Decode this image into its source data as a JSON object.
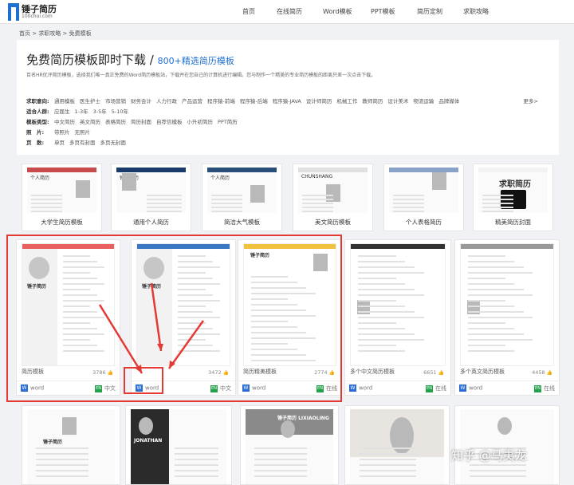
{
  "logo": {
    "name": "锤子简历",
    "domain": "100chui.com"
  },
  "nav": [
    "首页",
    "在线简历",
    "Word模板",
    "PPT模板",
    "简历定制",
    "求职攻略"
  ],
  "breadcrumb": "首页 > 求职攻略 > 免费模板",
  "heading": {
    "title": "免费简历模板即时下载 /",
    "subtitle": "800+精选简历模板",
    "desc": "百名HR优评简历模板，选择我们唯一真正免费的Word简历模板站，下载并在您自己的计算机进行编辑。您与制作一个精美的专业简历模板的距离只差一次点击下载。"
  },
  "filters": [
    {
      "label": "求职意向:",
      "options": [
        "通用模板",
        "医生护士",
        "市场营销",
        "财务会计",
        "人力行政",
        "产品运营",
        "程序猿-前端",
        "程序猿-后端",
        "程序猿-JAVA",
        "设计师简历",
        "机械工作",
        "教师简历",
        "设计美术",
        "物流运输",
        "品牌媒体"
      ]
    },
    {
      "label": "适合人群:",
      "options": [
        "应届生",
        "1-3年",
        "3-5年",
        "5-10年"
      ]
    },
    {
      "label": "模板类型:",
      "options": [
        "中文简历",
        "英文简历",
        "表格简历",
        "简历封面",
        "自荐信模板",
        "小升初简历",
        "PPT简历"
      ]
    },
    {
      "label": "照　片:",
      "options": [
        "带照片",
        "无照片"
      ]
    },
    {
      "label": "页　数:",
      "options": [
        "单页",
        "多页有封面",
        "多页无封面"
      ]
    }
  ],
  "more": "更多>",
  "categories": [
    "大学生简历模板",
    "通用个人简历",
    "简洁大气模板",
    "美文简历模板",
    "个人表格简历",
    "精美简历封面"
  ],
  "category_thumb_texts": [
    "个人简历",
    "锤子简历",
    "个人简历",
    "CHUNSHANG",
    "",
    "求职简历"
  ],
  "templates": [
    {
      "name": "简历模板",
      "count": "3786",
      "format": "word",
      "lang": "中文"
    },
    {
      "name": "",
      "count": "3472",
      "format": "word",
      "lang": "中文"
    },
    {
      "name": "简历精美模板",
      "count": "2774",
      "format": "word",
      "lang": "在线"
    },
    {
      "name": "多个中文简历模板",
      "count": "6651",
      "format": "word",
      "lang": "在线"
    },
    {
      "name": "多个英文简历模板",
      "count": "4458",
      "format": "word",
      "lang": "在线"
    }
  ],
  "template_heads": [
    "锤子简历",
    "锤子简历",
    "锤子简历"
  ],
  "bottom_texts": [
    "锤子简历",
    "JONATHAN",
    "锤子简历 LIXIAOLING",
    "",
    ""
  ],
  "watermark": "知乎 @马夷龙",
  "colors": {
    "accent": "#1f6fd1",
    "highlight": "#e53935",
    "word_icon": "#2b6cd4",
    "lang_icon": "#22a04a"
  }
}
